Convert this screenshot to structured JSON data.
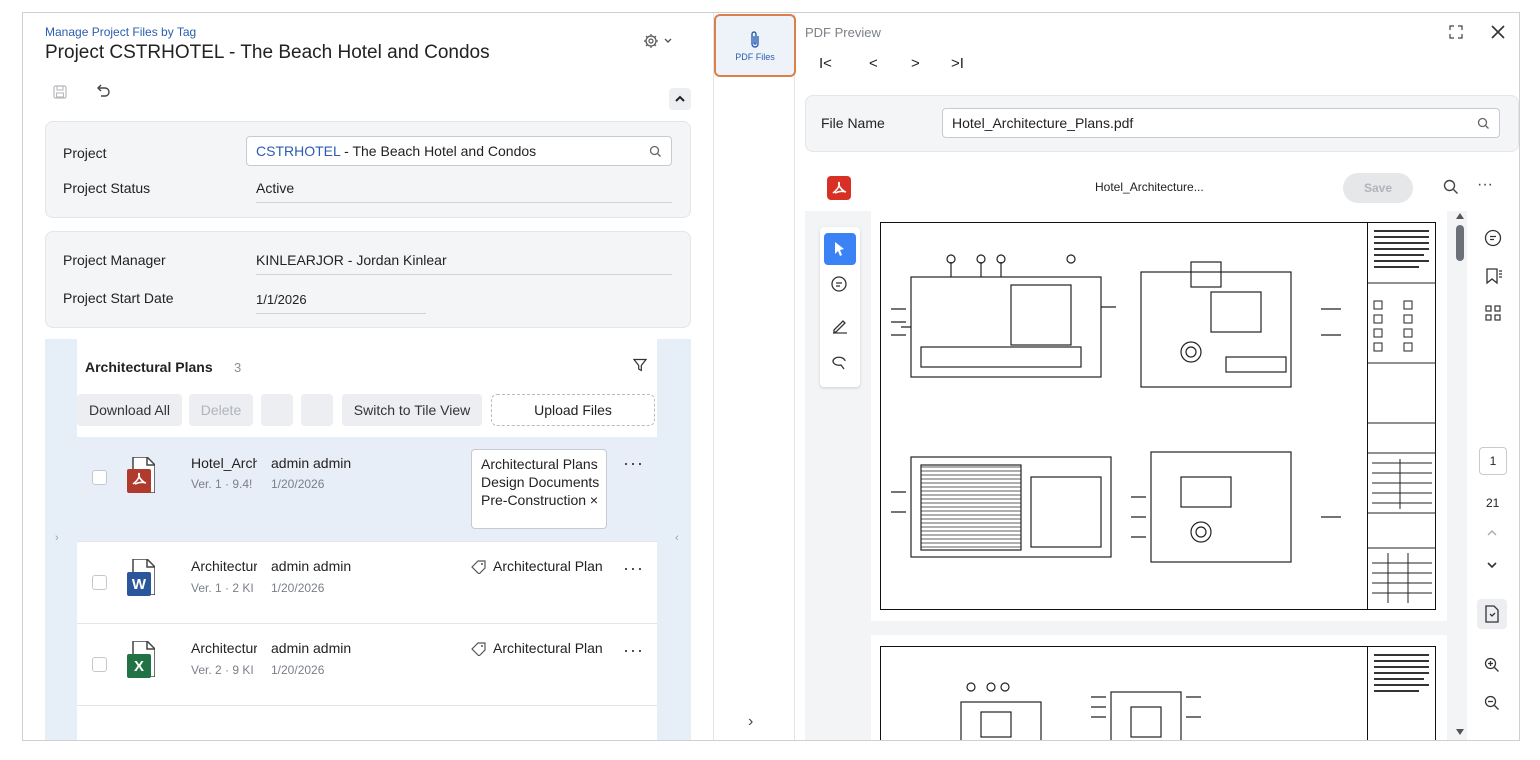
{
  "left": {
    "breadcrumb": "Manage Project Files by Tag",
    "title": "Project CSTRHOTEL - The Beach Hotel and Condos",
    "project_card": {
      "project_label": "Project",
      "project_code": "CSTRHOTEL",
      "project_name": " - The Beach Hotel and Condos",
      "status_label": "Project Status",
      "status_value": "Active"
    },
    "manager_card": {
      "manager_label": "Project Manager",
      "manager_value": "KINLEARJOR - Jordan Kinlear",
      "start_label": "Project Start Date",
      "start_value": "1/1/2026"
    },
    "files_grid": {
      "title": "Architectural Plans",
      "count": "3",
      "download_all": "Download All",
      "delete": "Delete",
      "switch_view": "Switch to Tile View",
      "upload": "Upload Files",
      "rows": [
        {
          "name": "Hotel_Archi",
          "meta": "Ver. 1 · 9.4!",
          "user": "admin admin",
          "date": "1/20/2026",
          "tags": [
            "Architectural Plans",
            "Design Documents",
            "Pre-Construction ×"
          ]
        },
        {
          "name": "Architecture",
          "meta": "Ver. 1 · 2 KI",
          "user": "admin admin",
          "date": "1/20/2026",
          "tag": "Architectural Plan"
        },
        {
          "name": "Architecture",
          "meta": "Ver. 2 · 9 KI",
          "user": "admin admin",
          "date": "1/20/2026",
          "tag": "Architectural Plan"
        }
      ],
      "badge_w": "W",
      "badge_x": "X"
    }
  },
  "middle": {
    "pdf_files_label": "PDF Files"
  },
  "right": {
    "header": "PDF Preview",
    "nav": {
      "first": "I<",
      "prev": "<",
      "next": ">",
      "last": ">I"
    },
    "file_name_label": "File Name",
    "file_name_value": "Hotel_Architecture_Plans.pdf",
    "viewer": {
      "doc_title": "Hotel_Architecture...",
      "save": "Save",
      "more": "···",
      "page_current": "1",
      "page_total": "21"
    }
  },
  "colors": {
    "accent_link": "#2a5db0",
    "pdf_red": "#c0392b",
    "word_blue": "#2b579a",
    "excel_green": "#217346",
    "selected_row": "#e8eef7",
    "active_tab_border": "#d9804b",
    "active_tool": "#3b82f6"
  }
}
